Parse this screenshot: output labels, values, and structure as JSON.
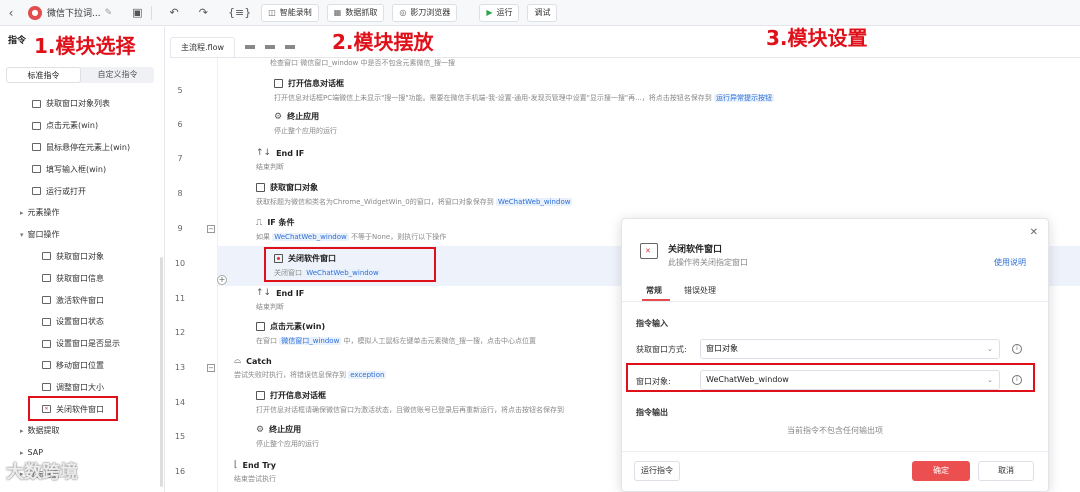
{
  "toolbar": {
    "back_icon": "back-arrow-icon",
    "title": "微信下拉词...",
    "items": {
      "smart_record": "智能录制",
      "data_capture": "数据抓取",
      "browser": "影刀浏览器",
      "run": "运行",
      "debug": "调试"
    },
    "code_glyph": "{≡}"
  },
  "annotations": {
    "a1": "1.模块选择",
    "a2": "2.模块摆放",
    "a3": "3.模块设置"
  },
  "sidebar": {
    "header": "指令",
    "tabs": [
      "标准指令",
      "自定义指令"
    ],
    "items": [
      {
        "label": "获取窗口对象列表",
        "level": 1
      },
      {
        "label": "点击元素(win)",
        "level": 1
      },
      {
        "label": "鼠标悬停在元素上(win)",
        "level": 1
      },
      {
        "label": "填写输入框(win)",
        "level": 1
      },
      {
        "label": "运行或打开",
        "level": 1
      },
      {
        "label": "元素操作",
        "level": 0
      },
      {
        "label": "窗口操作",
        "level": 0,
        "expanded": true
      },
      {
        "label": "获取窗口对象",
        "level": 2
      },
      {
        "label": "获取窗口信息",
        "level": 2
      },
      {
        "label": "激活软件窗口",
        "level": 2
      },
      {
        "label": "设置窗口状态",
        "level": 2
      },
      {
        "label": "设置窗口是否显示",
        "level": 2
      },
      {
        "label": "移动窗口位置",
        "level": 2
      },
      {
        "label": "调整窗口大小",
        "level": 2
      },
      {
        "label": "关闭软件窗口",
        "level": 2
      },
      {
        "label": "数据提取",
        "level": 0
      },
      {
        "label": "SAP",
        "level": 0
      },
      {
        "label": "鼠标键盘",
        "level": 0
      }
    ]
  },
  "tabs": {
    "main": "主流程.flow"
  },
  "flow": {
    "partial_top": "检查窗口 微信窗口_window 中是否不包含元素微信_搜一搜",
    "steps": [
      {
        "line": "5",
        "title": "打开信息对话框",
        "desc_a": "打开信息对话框PC端微信上未显示\"搜一搜\"功能。需要在微信手机端-我-设置-通用-发现页管理中设置\"显示搜一搜\"再...，将点击按钮名保存到",
        "chip": "运行异常提示按钮"
      },
      {
        "line": "6",
        "title": "终止应用",
        "desc_a": "停止整个应用的运行"
      },
      {
        "line": "7",
        "title": "End IF",
        "desc_a": "结束判断"
      },
      {
        "line": "8",
        "title": "获取窗口对象",
        "desc_a": "获取标题为微信和类名为Chrome_WidgetWin_0的窗口，将窗口对象保存到",
        "chip": "WeChatWeb_window"
      },
      {
        "line": "9",
        "title": "IF 条件",
        "desc_pre": "如果",
        "chip": "WeChatWeb_window",
        "desc_a": "不等于None，则执行以下操作"
      },
      {
        "line": "10",
        "title": "关闭软件窗口",
        "desc_pre": "关闭窗口",
        "chip": "WeChatWeb_window"
      },
      {
        "line": "11",
        "title": "End IF",
        "desc_a": "结束判断"
      },
      {
        "line": "12",
        "title": "点击元素(win)",
        "desc_pre": "在窗口",
        "chip": "微信窗口_window",
        "desc_a": "中，模拟人工鼠标左键单击元素微信_搜一搜，点击中心点位置"
      },
      {
        "line": "13",
        "title": "Catch",
        "desc_a": "尝试失败时执行，将错误信息保存到",
        "chip": "exception"
      },
      {
        "line": "14",
        "title": "打开信息对话框",
        "desc_a": "打开信息对话框请确保微信窗口为激活状态，且微信账号已登录后再重新运行，将点击按钮名保存到"
      },
      {
        "line": "15",
        "title": "终止应用",
        "desc_a": "停止整个应用的运行"
      },
      {
        "line": "16",
        "title": "End Try",
        "desc_a": "结束尝试执行"
      }
    ]
  },
  "dialog": {
    "title": "关闭软件窗口",
    "description": "此操作将关闭指定窗口",
    "help": "使用说明",
    "tabs": [
      "常规",
      "错误处理"
    ],
    "input_section": "指令输入",
    "fields": [
      {
        "label": "获取窗口方式:",
        "value": "窗口对象"
      },
      {
        "label": "窗口对象:",
        "value": "WeChatWeb_window"
      }
    ],
    "output_section": "指令输出",
    "output_empty": "当前指令不包含任何输出项",
    "run_button": "运行指令",
    "ok_button": "确定",
    "cancel_button": "取消"
  },
  "watermark": "大数跨境",
  "colors": {
    "annotation": "#e0101a",
    "accent": "#ec4f4f",
    "variable_chip": "#2f6fd6"
  }
}
